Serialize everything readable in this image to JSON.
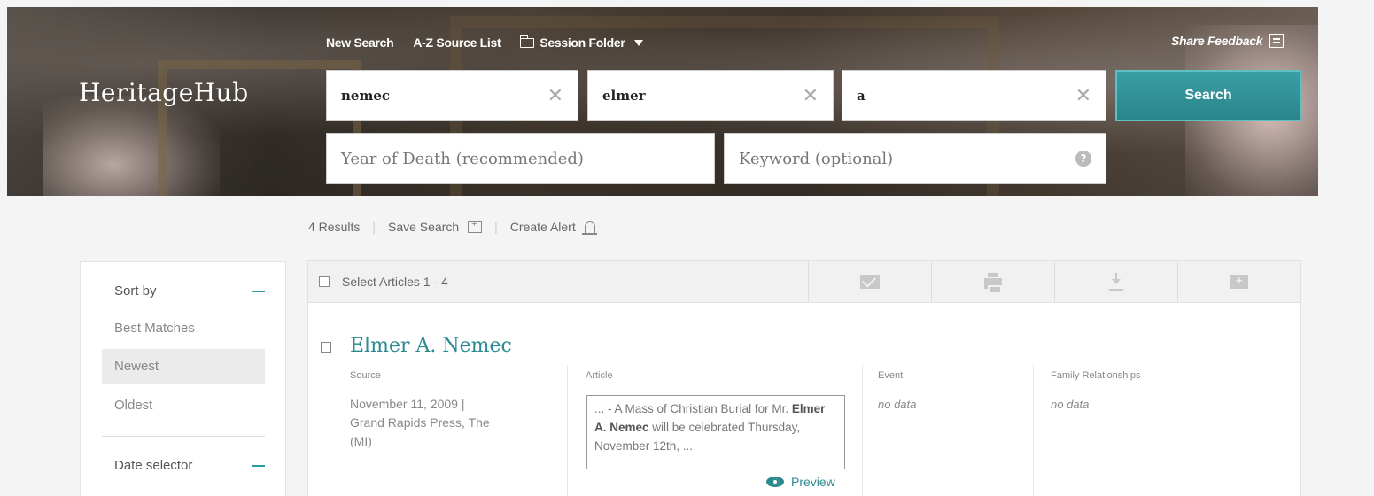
{
  "brand": {
    "logo": "HeritageHub"
  },
  "topnav": {
    "new_search": "New Search",
    "az_source_list": "A-Z Source List",
    "session_folder": "Session Folder",
    "share_feedback": "Share Feedback"
  },
  "search": {
    "last_name": "nemec",
    "first_name": "elmer",
    "middle_name": "a",
    "year_of_death_placeholder": "Year of Death (recommended)",
    "keyword_placeholder": "Keyword (optional)",
    "button": "Search"
  },
  "results_bar": {
    "count": "4 Results",
    "save_search": "Save Search",
    "create_alert": "Create Alert"
  },
  "sidebar": {
    "sort_by": "Sort by",
    "items": [
      {
        "label": "Best Matches"
      },
      {
        "label": "Newest"
      },
      {
        "label": "Oldest"
      }
    ],
    "date_selector": "Date selector"
  },
  "toolbar": {
    "select_articles": "Select Articles 1 - 4"
  },
  "result": {
    "title": "Elmer A. Nemec",
    "labels": {
      "source": "Source",
      "article": "Article",
      "event": "Event",
      "family": "Family Relationships"
    },
    "source_line1": "November 11, 2009 |",
    "source_line2": "Grand Rapids Press, The",
    "source_line3": "(MI)",
    "snippet_pre": "... - A Mass of Christian Burial for Mr.",
    "snippet_bold": "Elmer A. Nemec",
    "snippet_post": " will be celebrated Thursday, November 12th, ...",
    "event": "no data",
    "family": "no data",
    "preview": "Preview"
  },
  "colors": {
    "accent": "#2b8a8f",
    "button": "#2b868b"
  }
}
